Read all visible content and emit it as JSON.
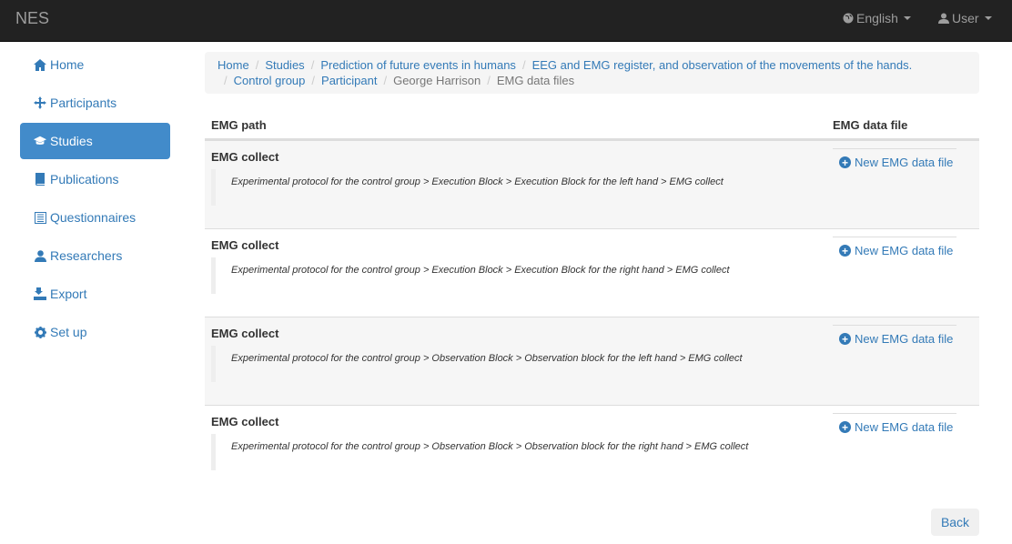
{
  "navbar": {
    "brand": "NES",
    "language": "English",
    "user": "User"
  },
  "sidebar": {
    "items": [
      {
        "label": "Home",
        "icon": "home-icon"
      },
      {
        "label": "Participants",
        "icon": "participants-icon"
      },
      {
        "label": "Studies",
        "icon": "studies-icon",
        "active": true
      },
      {
        "label": "Publications",
        "icon": "book-icon"
      },
      {
        "label": "Questionnaires",
        "icon": "list-icon"
      },
      {
        "label": "Researchers",
        "icon": "user-icon"
      },
      {
        "label": "Export",
        "icon": "export-icon"
      },
      {
        "label": "Set up",
        "icon": "gear-icon"
      }
    ]
  },
  "breadcrumb": [
    {
      "label": "Home"
    },
    {
      "label": "Studies"
    },
    {
      "label": "Prediction of future events in humans"
    },
    {
      "label": "EEG and EMG register, and observation of the movements of the hands."
    },
    {
      "label": "Control group"
    },
    {
      "label": "Participant"
    },
    {
      "label": "George Harrison"
    },
    {
      "label": "EMG data files"
    }
  ],
  "table": {
    "headers": {
      "path": "EMG path",
      "file": "EMG data file"
    },
    "rows": [
      {
        "title": "EMG collect",
        "path": "Experimental protocol for the control group > Execution Block > Execution Block for the left hand > EMG collect",
        "action": "New EMG data file"
      },
      {
        "title": "EMG collect",
        "path": "Experimental protocol for the control group > Execution Block > Execution Block for the right hand > EMG collect",
        "action": "New EMG data file"
      },
      {
        "title": "EMG collect",
        "path": "Experimental protocol for the control group > Observation Block > Observation block for the left hand > EMG collect",
        "action": "New EMG data file"
      },
      {
        "title": "EMG collect",
        "path": "Experimental protocol for the control group > Observation Block > Observation block for the right hand > EMG collect",
        "action": "New EMG data file"
      }
    ]
  },
  "back_label": "Back",
  "colors": {
    "navbar": "#222222",
    "link": "#337ab7",
    "active": "#428bca"
  }
}
